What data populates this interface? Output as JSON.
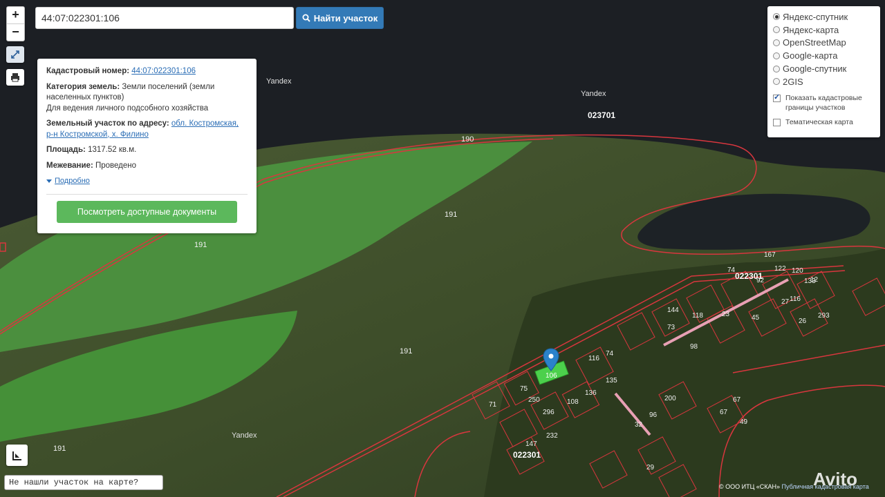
{
  "search": {
    "value": "44:07:022301:106",
    "button_label": "Найти участок"
  },
  "zoom": {
    "in_label": "+",
    "out_label": "−"
  },
  "info": {
    "cadastral_label": "Кадастровый номер:",
    "cadastral_value": "44:07:022301:106",
    "category_label": "Категория земель:",
    "category_value": "Земли поселений (земли населенных пунктов)",
    "usage_value": "Для ведения личного подсобного хозяйства",
    "address_label": "Земельный участок по адресу:",
    "address_value": "обл. Костромская, р-н Костромской, х. Филино",
    "area_label": "Площадь:",
    "area_value": "1317.52 кв.м.",
    "survey_label": "Межевание:",
    "survey_value": "Проведено",
    "more_label": "Подробно",
    "docs_button": "Посмотреть доступные документы"
  },
  "layers": {
    "options": [
      {
        "label": "Яндекс-спутник",
        "selected": true
      },
      {
        "label": "Яндекс-карта",
        "selected": false
      },
      {
        "label": "OpenStreetMap",
        "selected": false
      },
      {
        "label": "Google-карта",
        "selected": false
      },
      {
        "label": "Google-спутник",
        "selected": false
      },
      {
        "label": "2GIS",
        "selected": false
      }
    ],
    "show_boundaries_label": "Показать кадастровые границы участков",
    "show_boundaries_checked": true,
    "thematic_label": "Тематическая карта",
    "thematic_checked": false
  },
  "map_labels": {
    "watermark": "Yandex",
    "quarter_north": "023701",
    "quarter_village": "022301",
    "quarter_south": "022301",
    "parcel_190": "190",
    "parcel_191": "191",
    "parcel_selected": "106",
    "parcel_numbers": [
      "120",
      "12",
      "167",
      "122",
      "27",
      "116",
      "144",
      "73",
      "118",
      "98",
      "250",
      "296",
      "75",
      "71",
      "136",
      "135",
      "108",
      "116",
      "74",
      "74",
      "23",
      "200",
      "232",
      "147",
      "96",
      "67",
      "32",
      "29",
      "92",
      "26",
      "293",
      "45",
      "133",
      "67",
      "49"
    ]
  },
  "not_found": "Не нашли участок на карте?",
  "copyright": {
    "text": "© ООО ИТЦ «СКАН»",
    "link": "Публичная кадастровая карта"
  },
  "avito": "Avito",
  "colors": {
    "water": "#1c1f24",
    "field": "#3f8a3a",
    "boundary": "#d9363e",
    "marker": "#2b82cb",
    "search_button": "#337ab7",
    "docs_button": "#5cb85c"
  }
}
